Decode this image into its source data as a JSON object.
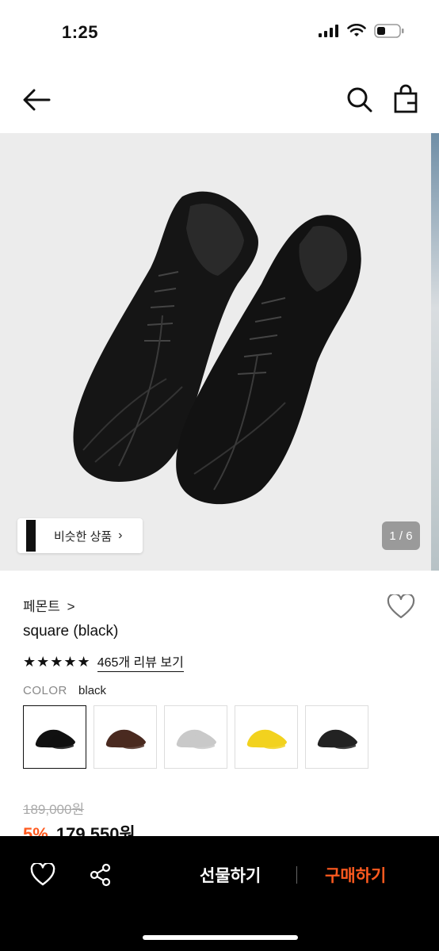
{
  "status": {
    "time": "1:25"
  },
  "gallery": {
    "similar_label": "비슷한 상품",
    "counter": "1 / 6"
  },
  "product": {
    "brand": "페몬트",
    "brand_chevron": ">",
    "name": "square (black)",
    "stars": "★★★★★",
    "reviews": "465개 리뷰 보기",
    "color_label": "COLOR",
    "color_value": "black",
    "swatch_colors": [
      "#111111",
      "#4a2a20",
      "#c9c9c9",
      "#f2d21e",
      "#222222"
    ],
    "old_price": "189,000원",
    "discount": "5%",
    "price": "179,550원"
  },
  "actions": {
    "gift": "선물하기",
    "buy": "구매하기"
  },
  "colors": {
    "accent": "#ff5a1f"
  }
}
